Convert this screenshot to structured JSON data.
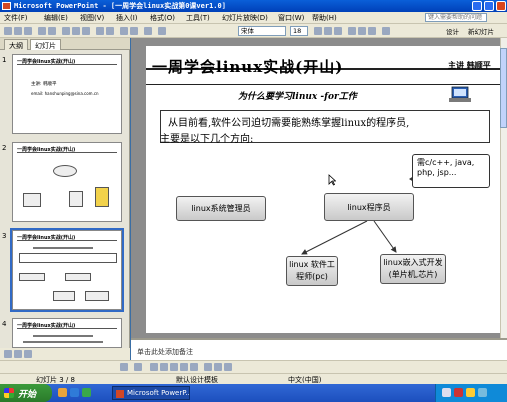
{
  "window": {
    "title": "Microsoft PowerPoint - [一周学会linux实战第0课ver1.0]"
  },
  "menu": {
    "items": [
      "文件(F)",
      "编辑(E)",
      "视图(V)",
      "插入(I)",
      "格式(O)",
      "工具(T)",
      "幻灯片放映(D)",
      "窗口(W)",
      "帮助(H)"
    ],
    "help_placeholder": "键入需要帮助的问题"
  },
  "toolbar": {
    "font": "宋体",
    "size": "18",
    "design_label": "设计",
    "new_slide_label": "新幻灯片"
  },
  "panel": {
    "tabs": [
      "大纲",
      "幻灯片"
    ],
    "slide_numbers": [
      "1",
      "2",
      "3",
      "4"
    ],
    "thumb_titles": [
      "一周学会linux实战(开山)",
      "一周学会linux实战(开山)",
      "一周学会linux实战(开山)",
      "一周学会linux实战(开山)"
    ],
    "thumb1_lines": [
      "主讲: 韩顺平",
      "email: hanshunping@sina.com.cn"
    ]
  },
  "slide": {
    "title": "一周学会linux实战(开山)",
    "author": "主讲 韩顺平",
    "subtitle": "为什么要学习linux   -for工作",
    "paragraph_line1": "从目前看,软件公司迫切需要能熟练掌握linux的程序员,",
    "paragraph_line2": "主要是以下几个方向:",
    "nodes": {
      "sysadmin": "linux系统管理员",
      "programmer": "linux程序员",
      "software_engineer": "linux 软件工程师(pc)",
      "embedded": "linux嵌入式开发(单片机,芯片)"
    },
    "callout": "需c/c++, java, php, jsp..."
  },
  "notes": {
    "placeholder": "单击此处添加备注"
  },
  "status": {
    "slide_counter": "幻灯片 3 / 8",
    "design": "默认设计模板",
    "language": "中文(中国)"
  },
  "taskbar": {
    "start_label": "开始",
    "item_label": "Microsoft PowerP..."
  }
}
